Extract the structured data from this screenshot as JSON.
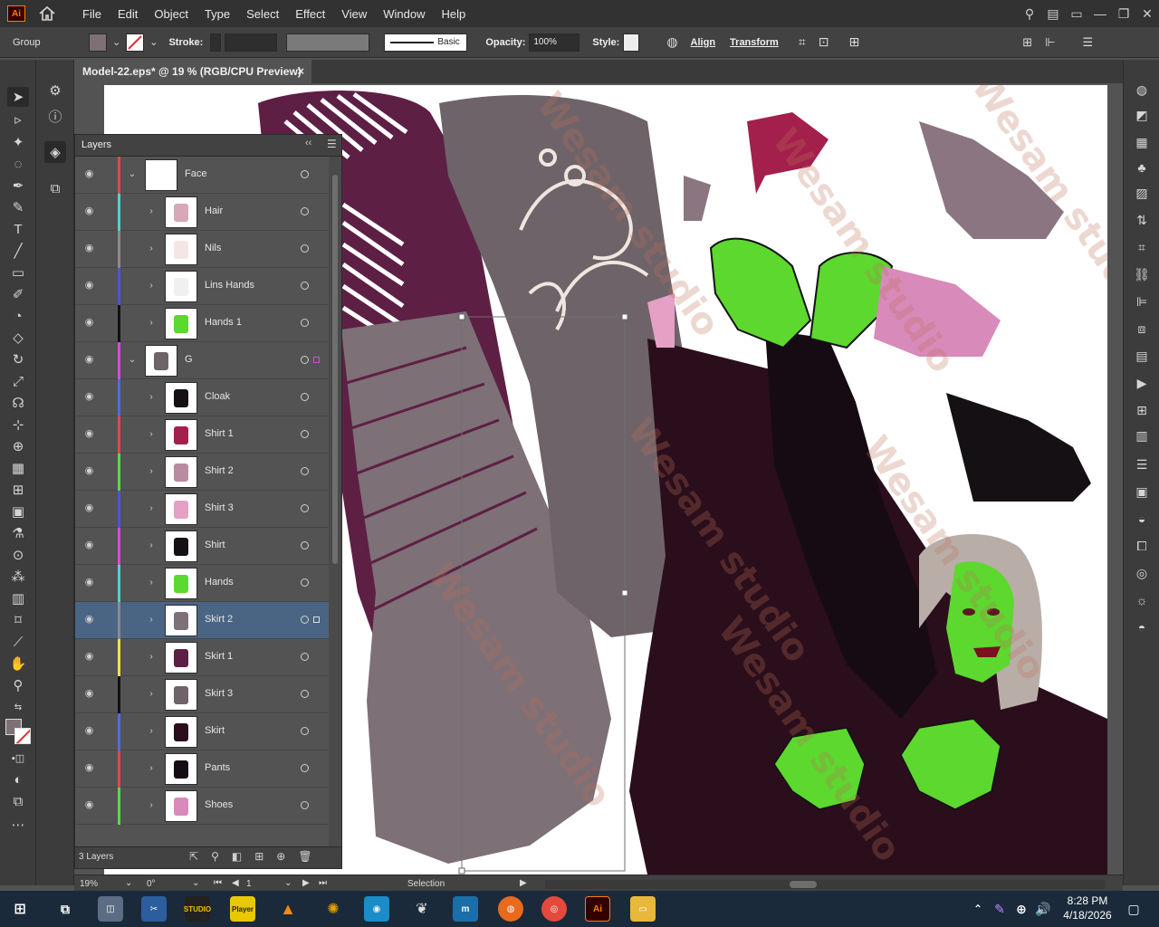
{
  "app": {
    "logo": "Ai"
  },
  "menu": {
    "items": [
      "File",
      "Edit",
      "Object",
      "Type",
      "Select",
      "Effect",
      "View",
      "Window",
      "Help"
    ]
  },
  "control": {
    "selection_type": "Group",
    "stroke_label": "Stroke:",
    "brush_label": "Basic",
    "opacity_label": "Opacity:",
    "opacity_value": "100%",
    "style_label": "Style:",
    "align_label": "Align",
    "transform_label": "Transform"
  },
  "document": {
    "tab_title": "Model-22.eps* @ 19 % (RGB/CPU Preview)"
  },
  "layers_panel": {
    "title": "Layers",
    "count_label": "3 Layers",
    "rows": [
      {
        "name": "Face",
        "color": "#e0464b"
      },
      {
        "name": "Hair",
        "color": "#4fd1d9"
      },
      {
        "name": "Nils",
        "color": "#8a8a8a"
      },
      {
        "name": "Lins Hands",
        "color": "#4a54d8"
      },
      {
        "name": "Hands 1",
        "color": "#111111"
      },
      {
        "name": "G",
        "color": "#d84adc"
      },
      {
        "name": "Cloak",
        "color": "#4a6fe0"
      },
      {
        "name": "Shirt 1",
        "color": "#e0464b"
      },
      {
        "name": "Shirt 2",
        "color": "#58d84a"
      },
      {
        "name": "Shirt 3",
        "color": "#4a54d8"
      },
      {
        "name": "Shirt",
        "color": "#d84adc"
      },
      {
        "name": "Hands",
        "color": "#4fd1d9"
      },
      {
        "name": "Skirt 2",
        "color": "#8a8a8a"
      },
      {
        "name": "Skirt 1",
        "color": "#f0e04a"
      },
      {
        "name": "Skirt 3",
        "color": "#111111"
      },
      {
        "name": "Skirt",
        "color": "#4a6fe0"
      },
      {
        "name": "Pants",
        "color": "#e0464b"
      },
      {
        "name": "Shoes",
        "color": "#58d84a"
      }
    ]
  },
  "status": {
    "zoom": "19%",
    "rotation": "0°",
    "page": "1",
    "tool": "Selection"
  },
  "taskbar": {
    "time": "8:28 PM",
    "date": "4/18/2026"
  },
  "watermark": "Wesam studio"
}
